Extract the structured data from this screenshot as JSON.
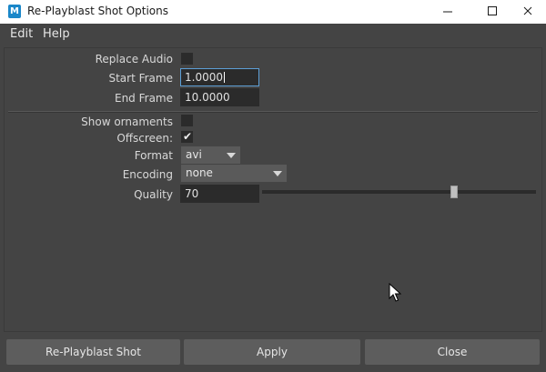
{
  "window": {
    "app_icon_letter": "M",
    "title": "Re-Playblast Shot Options",
    "controls": [
      "minimize-icon",
      "maximize-icon",
      "close-icon"
    ]
  },
  "menubar": {
    "items": [
      {
        "label": "Edit"
      },
      {
        "label": "Help"
      }
    ]
  },
  "form": {
    "replace_audio": {
      "label": "Replace Audio",
      "checked": false
    },
    "start_frame": {
      "label": "Start Frame",
      "value": "1.0000"
    },
    "end_frame": {
      "label": "End Frame",
      "value": "10.0000"
    },
    "show_ornaments": {
      "label": "Show ornaments",
      "checked": false
    },
    "offscreen": {
      "label": "Offscreen:",
      "checked": true,
      "check_glyph": "✔"
    },
    "format": {
      "label": "Format",
      "value": "avi"
    },
    "encoding": {
      "label": "Encoding",
      "value": "none"
    },
    "quality": {
      "label": "Quality",
      "value": "70",
      "slider_fraction": 0.7
    }
  },
  "buttons": {
    "replayblast": "Re-Playblast Shot",
    "apply": "Apply",
    "close": "Close"
  },
  "colors": {
    "panel_bg": "#444444",
    "field_bg": "#2b2b2b",
    "button_bg": "#5d5d5d",
    "focus_border": "#5d9fd6",
    "app_icon": "#1a87c9"
  }
}
